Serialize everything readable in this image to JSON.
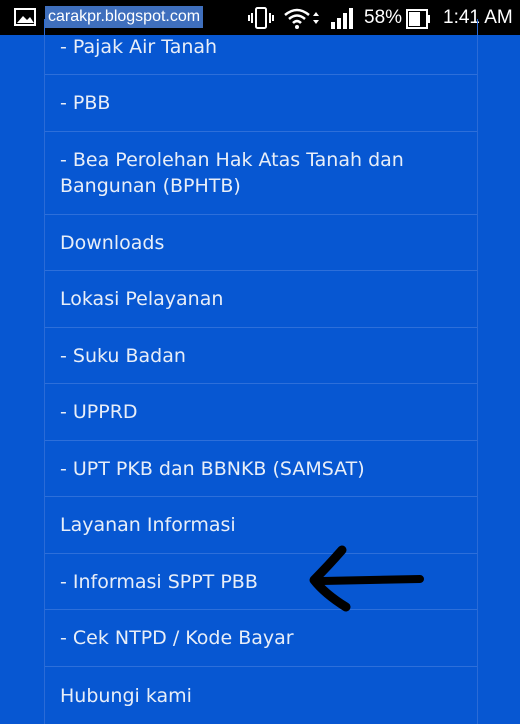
{
  "status_bar": {
    "watermark": "carakpr.blogspot.com",
    "battery_percent": "58%",
    "time": "1:41 AM",
    "icons": [
      "gallery-icon",
      "vibrate-icon",
      "wifi-icon",
      "signal-icon",
      "battery-icon"
    ]
  },
  "menu": {
    "items": [
      "- Pajak Air Tanah",
      "- PBB",
      "- Bea Perolehan Hak Atas Tanah dan Bangunan (BPHTB)",
      "Downloads",
      "Lokasi Pelayanan",
      "- Suku Badan",
      "- UPPRD",
      "- UPT PKB dan BBNKB (SAMSAT)",
      "Layanan Informasi",
      "- Informasi SPPT PBB",
      "- Cek NTPD / Kode Bayar",
      "Hubungi kami"
    ]
  },
  "colors": {
    "background": "#0757d2",
    "status_bar": "#000000",
    "menu_text": "#e8eef8",
    "divider": "#2d6fda",
    "annotation_arrow": "#000000"
  }
}
